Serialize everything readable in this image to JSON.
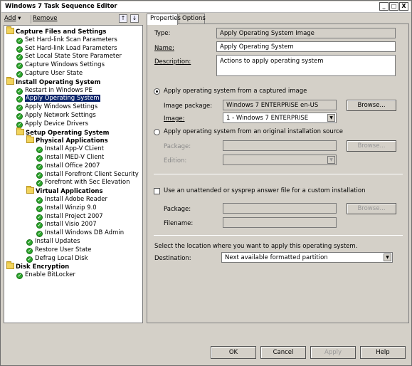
{
  "window": {
    "title": "Windows 7 Task Sequence Editor",
    "minimize": "_",
    "maximize": "□",
    "close": "X"
  },
  "toolbar": {
    "add": "Add",
    "remove": "Remove"
  },
  "tree": [
    {
      "label": "Capture Files and Settings",
      "type": "group",
      "level": 0
    },
    {
      "label": "Set Hard-link Scan Parameters",
      "type": "step",
      "level": 1
    },
    {
      "label": "Set Hard-link Load Parameters",
      "type": "step",
      "level": 1
    },
    {
      "label": "Set Local State Store Parameter",
      "type": "step",
      "level": 1
    },
    {
      "label": "Capture Windows Settings",
      "type": "step",
      "level": 1
    },
    {
      "label": "Capture User State",
      "type": "step",
      "level": 1
    },
    {
      "label": "Install Operating System",
      "type": "group",
      "level": 0
    },
    {
      "label": "Restart in Windows PE",
      "type": "step",
      "level": 1
    },
    {
      "label": "Apply Operating System",
      "type": "step",
      "level": 1,
      "selected": true
    },
    {
      "label": "Apply Windows Settings",
      "type": "step",
      "level": 1
    },
    {
      "label": "Apply Network Settings",
      "type": "step",
      "level": 1
    },
    {
      "label": "Apply Device Drivers",
      "type": "step",
      "level": 1
    },
    {
      "label": "Setup Operating System",
      "type": "group",
      "level": 1
    },
    {
      "label": "Physical Applications",
      "type": "group",
      "level": 2
    },
    {
      "label": "Install App-V CLient",
      "type": "step",
      "level": 3
    },
    {
      "label": "Install MED-V Client",
      "type": "step",
      "level": 3
    },
    {
      "label": "Install Office 2007",
      "type": "step",
      "level": 3
    },
    {
      "label": "Install Forefront Client Security",
      "type": "step",
      "level": 3
    },
    {
      "label": "Forefront with Sec Elevation",
      "type": "step",
      "level": 3
    },
    {
      "label": "Virtual Applications",
      "type": "group",
      "level": 2
    },
    {
      "label": "Install Adobe Reader",
      "type": "step",
      "level": 3
    },
    {
      "label": "Install Winzip 9.0",
      "type": "step",
      "level": 3
    },
    {
      "label": "Install Project 2007",
      "type": "step",
      "level": 3
    },
    {
      "label": "Install Visio 2007",
      "type": "step",
      "level": 3
    },
    {
      "label": "Install Windows DB Admin",
      "type": "step",
      "level": 3
    },
    {
      "label": "Install Updates",
      "type": "step",
      "level": 2
    },
    {
      "label": "Restore User State",
      "type": "step",
      "level": 2
    },
    {
      "label": "Defrag Local Disk",
      "type": "step",
      "level": 2
    },
    {
      "label": "Disk Encryption",
      "type": "group",
      "level": 0
    },
    {
      "label": "Enable BitLocker",
      "type": "step",
      "level": 1
    }
  ],
  "tabs": {
    "properties": "Properties",
    "options": "Options"
  },
  "props": {
    "type_label": "Type:",
    "type_value": "Apply Operating System Image",
    "name_label": "Name:",
    "name_value": "Apply Operating System",
    "desc_label": "Description:",
    "desc_value": "Actions to apply operating system",
    "radio_captured": "Apply operating system from a captured image",
    "image_package_label": "Image package:",
    "image_package_value": "Windows 7 ENTERPRISE  en-US",
    "browse1": "Browse...",
    "image_label": "Image:",
    "image_value": "1 - Windows 7 ENTERPRISE",
    "radio_original": "Apply operating system from an original installation source",
    "package_label": "Package:",
    "browse2": "Browse...",
    "edition_label": "Edition:",
    "unattend_check": "Use an unattended or sysprep answer file for a custom installation",
    "package2_label": "Package:",
    "browse3": "Browse...",
    "filename_label": "Filename:",
    "location_text": "Select the location where you want to apply this operating system.",
    "destination_label": "Destination:",
    "destination_value": "Next available formatted partition"
  },
  "buttons": {
    "ok": "OK",
    "cancel": "Cancel",
    "apply": "Apply",
    "help": "Help"
  }
}
